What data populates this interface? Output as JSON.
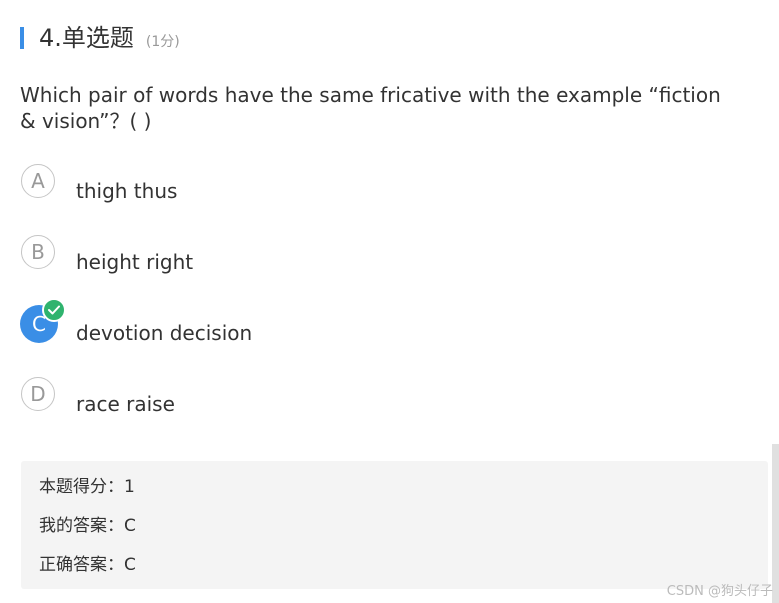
{
  "question": {
    "number_title": "4.单选题",
    "score_note": "(1分)",
    "text": "Which pair of words have the same fricative with the example  “fiction & vision”？(        )"
  },
  "options": [
    {
      "letter": "A",
      "text": "thigh thus",
      "selected": false
    },
    {
      "letter": "B",
      "text": "height right",
      "selected": false
    },
    {
      "letter": "C",
      "text": "devotion decision",
      "selected": true
    },
    {
      "letter": "D",
      "text": "race raise",
      "selected": false
    }
  ],
  "result": {
    "score_label": "本题得分：",
    "score_value": "1",
    "my_answer_label": "我的答案：",
    "my_answer_value": "C",
    "correct_answer_label": "正确答案：",
    "correct_answer_value": "C"
  },
  "watermark": "CSDN @狗头仔子",
  "colors": {
    "accent": "#3a8ee6",
    "correct": "#2fb36e",
    "result_bg": "#f4f4f4"
  },
  "icons": {
    "correct_badge": "check-icon"
  }
}
